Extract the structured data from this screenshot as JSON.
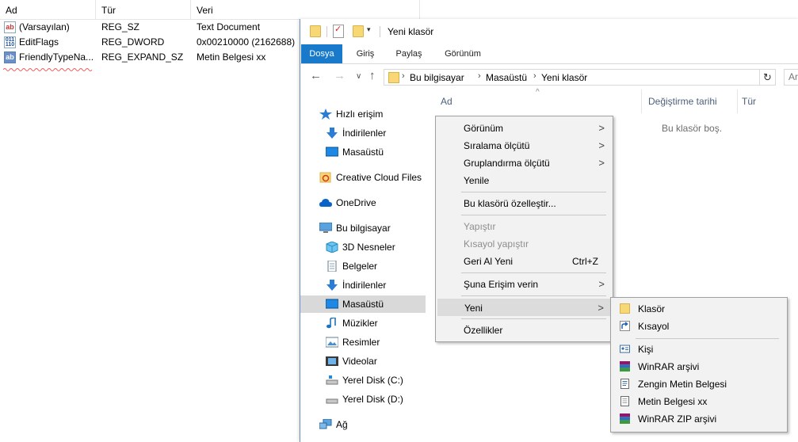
{
  "registry": {
    "columns": [
      "Ad",
      "Tür",
      "Veri"
    ],
    "rows": [
      {
        "name": "(Varsayılan)",
        "type": "REG_SZ",
        "data": "Text Document",
        "icon": "string-value-icon"
      },
      {
        "name": "EditFlags",
        "type": "REG_DWORD",
        "data": "0x00210000 (2162688)",
        "icon": "binary-value-icon"
      },
      {
        "name": "FriendlyTypeNa...",
        "type": "REG_EXPAND_SZ",
        "data": "Metin Belgesi xx",
        "icon": "string-value-icon"
      }
    ]
  },
  "explorer": {
    "title": "Yeni klasör",
    "ribbon_tabs": [
      "Dosya",
      "Giriş",
      "Paylaş",
      "Görünüm"
    ],
    "breadcrumb": [
      "Bu bilgisayar",
      "Masaüstü",
      "Yeni klasör"
    ],
    "search_placeholder": "Ar",
    "nav_items": [
      {
        "label": "Hızlı erişim",
        "icon": "star-icon"
      },
      {
        "label": "İndirilenler",
        "icon": "download-icon"
      },
      {
        "label": "Masaüstü",
        "icon": "desktop-icon"
      },
      {
        "label": "Creative Cloud Files",
        "icon": "creative-cloud-icon"
      },
      {
        "label": "OneDrive",
        "icon": "cloud-icon"
      },
      {
        "label": "Bu bilgisayar",
        "icon": "computer-icon"
      },
      {
        "label": "3D Nesneler",
        "icon": "cube-icon"
      },
      {
        "label": "Belgeler",
        "icon": "document-icon"
      },
      {
        "label": "İndirilenler",
        "icon": "download-icon"
      },
      {
        "label": "Masaüstü",
        "icon": "desktop-icon",
        "selected": true
      },
      {
        "label": "Müzikler",
        "icon": "music-icon"
      },
      {
        "label": "Resimler",
        "icon": "pictures-icon"
      },
      {
        "label": "Videolar",
        "icon": "video-icon"
      },
      {
        "label": "Yerel Disk (C:)",
        "icon": "drive-icon"
      },
      {
        "label": "Yerel Disk (D:)",
        "icon": "drive-icon"
      },
      {
        "label": "Ağ",
        "icon": "network-icon"
      }
    ],
    "columns": [
      "Ad",
      "Değiştirme tarihi",
      "Tür"
    ],
    "empty_message": "Bu klasör boş."
  },
  "context_menu": {
    "items": [
      {
        "label": "Görünüm",
        "submenu": true
      },
      {
        "label": "Sıralama ölçütü",
        "submenu": true
      },
      {
        "label": "Gruplandırma ölçütü",
        "submenu": true
      },
      {
        "label": "Yenile"
      },
      {
        "label": "Bu klasörü özelleştir..."
      },
      {
        "label": "Yapıştır",
        "disabled": true
      },
      {
        "label": "Kısayol yapıştır",
        "disabled": true
      },
      {
        "label": "Geri Al Yeni",
        "shortcut": "Ctrl+Z"
      },
      {
        "label": "Şuna Erişim verin",
        "submenu": true
      },
      {
        "label": "Yeni",
        "submenu": true,
        "highlighted": true
      },
      {
        "label": "Özellikler"
      }
    ]
  },
  "new_submenu": {
    "items": [
      {
        "label": "Klasör",
        "icon": "folder-icon"
      },
      {
        "label": "Kısayol",
        "icon": "shortcut-icon"
      },
      {
        "label": "Kişi",
        "icon": "contact-icon"
      },
      {
        "label": "WinRAR arşivi",
        "icon": "winrar-icon"
      },
      {
        "label": "Zengin Metin Belgesi",
        "icon": "rich-text-icon"
      },
      {
        "label": "Metin Belgesi xx",
        "icon": "text-document-icon"
      },
      {
        "label": "WinRAR ZIP arşivi",
        "icon": "winrar-zip-icon"
      }
    ]
  },
  "colors": {
    "accent": "#1979ca",
    "selected_nav": "#d9d9d9",
    "menu_bg": "#f2f2f2",
    "menu_hot": "#dcdcdc"
  }
}
